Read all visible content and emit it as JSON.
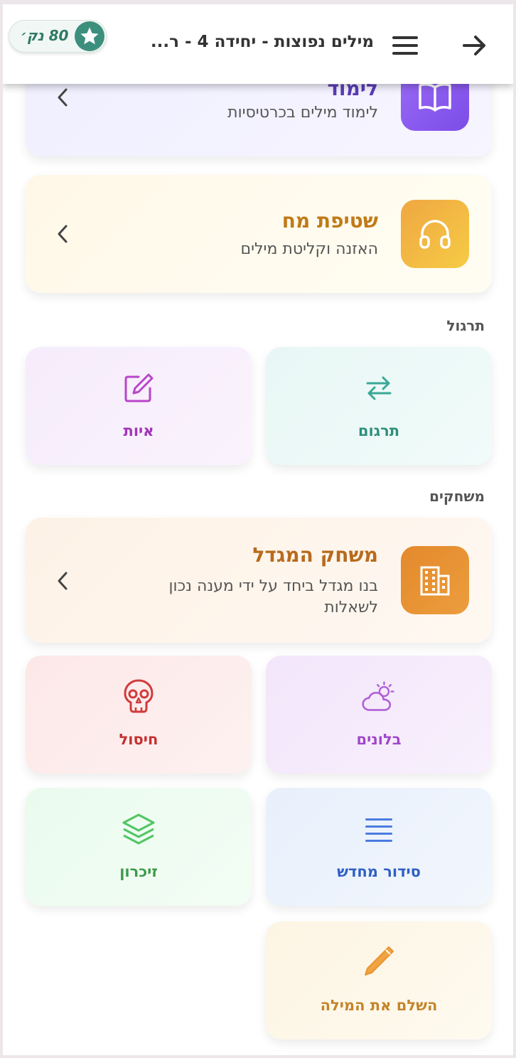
{
  "header": {
    "title": "מילים נפוצות - יחידה 4 - ר...",
    "points": "80 נק׳",
    "back_icon": "arrow-right-icon",
    "menu_icon": "hamburger-menu-icon",
    "star_icon": "star-icon"
  },
  "learn_card": {
    "title": "לימוד",
    "subtitle": "לימוד מילים בכרטיסיות",
    "icon": "book-open-icon",
    "accent": "#8b5cf6"
  },
  "brainwash_card": {
    "title": "שטיפת מח",
    "subtitle": "האזנה וקליטת מילים",
    "icon": "headphones-icon",
    "accent": "#f2b33d"
  },
  "practice_section": {
    "label": "תרגול",
    "tiles": [
      {
        "label": "תרגום",
        "icon": "arrows-swap-icon",
        "color": "#2f8f7a"
      },
      {
        "label": "איות",
        "icon": "edit-square-icon",
        "color": "#a235b8"
      }
    ]
  },
  "games_section": {
    "label": "משחקים",
    "tower_card": {
      "title": "משחק המגדל",
      "subtitle": "בנו מגדל ביחד על ידי מענה נכון לשאלות",
      "icon": "building-icon",
      "accent": "#e08a2e"
    },
    "tiles": [
      {
        "label": "בלונים",
        "icon": "cloud-sun-icon",
        "color": "#a047c9"
      },
      {
        "label": "חיסול",
        "icon": "skull-icon",
        "color": "#c62f2f"
      },
      {
        "label": "סידור מחדש",
        "icon": "lines-icon",
        "color": "#2f5fc4"
      },
      {
        "label": "זיכרון",
        "icon": "layers-icon",
        "color": "#3c9a4a"
      },
      {
        "label": "השלם את המילה",
        "icon": "pencil-icon",
        "color": "#c4842a"
      }
    ]
  }
}
